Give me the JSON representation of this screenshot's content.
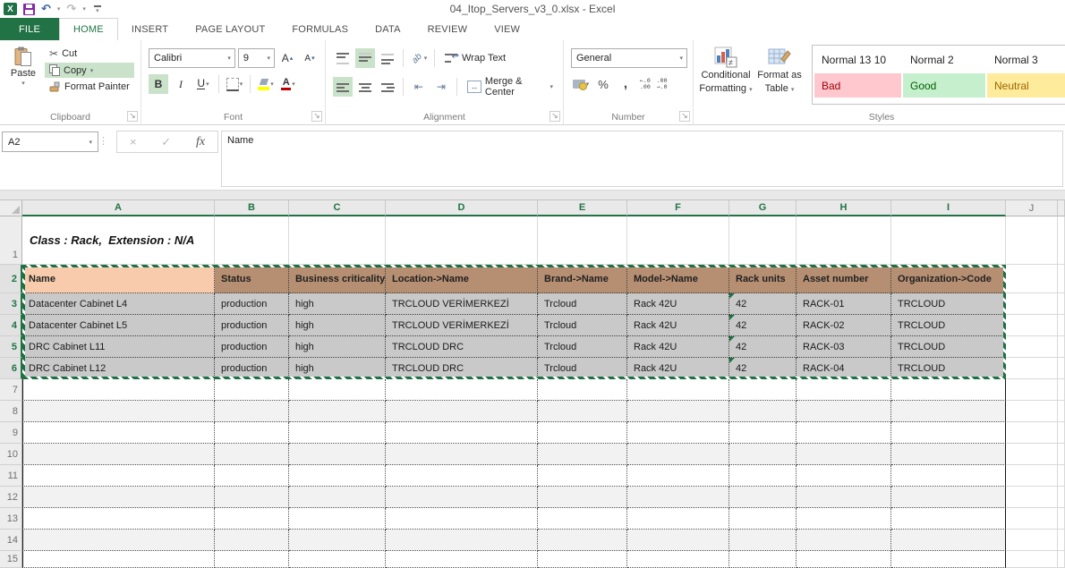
{
  "title_bar": {
    "title": "04_Itop_Servers_v3_0.xlsx - Excel"
  },
  "icons": {
    "excel_logo": "X",
    "undo": "↶",
    "redo": "↷",
    "caret_down": "▾",
    "caret_up": "▴",
    "scissors": "✂",
    "cancel": "×",
    "check": "✓",
    "fx": "fx",
    "dots": "⋮",
    "launcher": "↘",
    "wrap_return": "↩",
    "merge_arrows": "↔",
    "outdent": "⇤",
    "indent": "⇥",
    "orientation": "ab",
    "font_letter": "A"
  },
  "ribbon": {
    "tabs": [
      {
        "label": "FILE"
      },
      {
        "label": "HOME"
      },
      {
        "label": "INSERT"
      },
      {
        "label": "PAGE LAYOUT"
      },
      {
        "label": "FORMULAS"
      },
      {
        "label": "DATA"
      },
      {
        "label": "REVIEW"
      },
      {
        "label": "VIEW"
      }
    ],
    "clipboard": {
      "group_label": "Clipboard",
      "paste_label": "Paste",
      "cut_label": "Cut",
      "copy_label": "Copy",
      "format_painter_label": "Format Painter"
    },
    "font": {
      "group_label": "Font",
      "font_name": "Calibri",
      "font_size": "9",
      "bold_label": "B",
      "italic_label": "I",
      "underline_label": "U"
    },
    "alignment": {
      "group_label": "Alignment",
      "wrap_text_label": "Wrap Text",
      "merge_center_label": "Merge & Center"
    },
    "number": {
      "group_label": "Number",
      "format_value": "General",
      "percent_label": "%",
      "comma_label": ",",
      "inc_decimal_top": "←.0",
      "inc_decimal_bottom": ".00",
      "dec_decimal_top": ".00",
      "dec_decimal_bottom": "→.0"
    },
    "styles": {
      "group_label": "Styles",
      "cf_line1": "Conditional",
      "cf_line2": "Formatting",
      "fat_line1": "Format as",
      "fat_line2": "Table",
      "gallery": [
        {
          "label": "Normal 13 10",
          "bg": "#ffffff",
          "fg": "#1f1f1f"
        },
        {
          "label": "Normal 2",
          "bg": "#ffffff",
          "fg": "#1f1f1f"
        },
        {
          "label": "Normal 3",
          "bg": "#ffffff",
          "fg": "#1f1f1f"
        },
        {
          "label": "Bad",
          "bg": "#ffc7ce",
          "fg": "#9c0006"
        },
        {
          "label": "Good",
          "bg": "#c6efce",
          "fg": "#006100"
        },
        {
          "label": "Neutral",
          "bg": "#ffeb9c",
          "fg": "#9c6500"
        }
      ]
    }
  },
  "formula_bar": {
    "name_box": "A2",
    "content": "Name"
  },
  "sheet": {
    "columns": [
      {
        "letter": "A",
        "selected": true
      },
      {
        "letter": "B",
        "selected": true
      },
      {
        "letter": "C",
        "selected": true
      },
      {
        "letter": "D",
        "selected": true
      },
      {
        "letter": "E",
        "selected": true
      },
      {
        "letter": "F",
        "selected": true
      },
      {
        "letter": "G",
        "selected": true
      },
      {
        "letter": "H",
        "selected": true
      },
      {
        "letter": "I",
        "selected": true
      },
      {
        "letter": "J",
        "selected": false
      }
    ],
    "row_numbers": [
      "1",
      "2",
      "3",
      "4",
      "5",
      "6",
      "7",
      "8",
      "9",
      "10",
      "11",
      "12",
      "13",
      "14",
      "15"
    ],
    "title_cell": "Class : Rack,  Extension : N/A",
    "header_row": [
      "Name",
      "Status",
      "Business criticality",
      "Location->Name",
      "Brand->Name",
      "Model->Name",
      "Rack units",
      "Asset number",
      "Organization->Code"
    ],
    "data_rows": [
      [
        "Datacenter Cabinet L4",
        "production",
        "high",
        "TRCLOUD VERİMERKEZİ",
        "Trcloud",
        "Rack 42U",
        "42",
        "RACK-01",
        "TRCLOUD"
      ],
      [
        "Datacenter Cabinet L5",
        "production",
        "high",
        "TRCLOUD VERİMERKEZİ",
        "Trcloud",
        "Rack 42U",
        "42",
        "RACK-02",
        "TRCLOUD"
      ],
      [
        "DRC Cabinet L11",
        "production",
        "high",
        "TRCLOUD DRC",
        "Trcloud",
        "Rack 42U",
        "42",
        "RACK-03",
        "TRCLOUD"
      ],
      [
        "DRC Cabinet L12",
        "production",
        "high",
        "TRCLOUD DRC",
        "Trcloud",
        "Rack 42U",
        "42",
        "RACK-04",
        "TRCLOUD"
      ]
    ],
    "colors": {
      "accent_green": "#217346",
      "active_cell_fill": "#f8cbad",
      "header_fill": "#b68f73",
      "data_fill": "#c9c9c9",
      "band_fill": "#f2f2f2",
      "selection_border": "#217346",
      "error_indicator": "#1e7145"
    }
  }
}
